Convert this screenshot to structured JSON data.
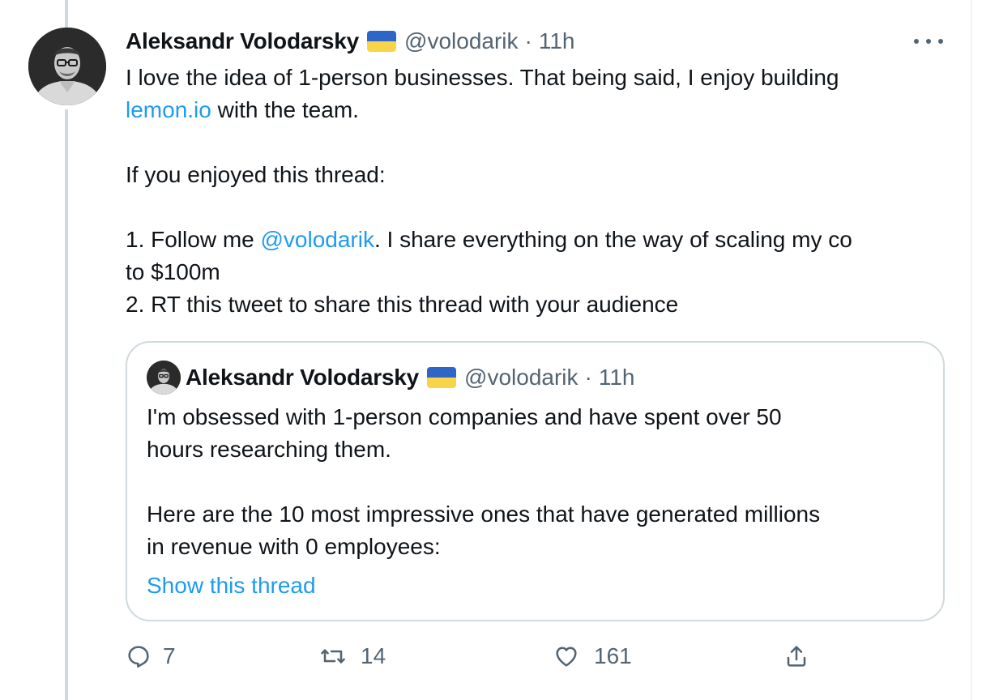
{
  "tweet": {
    "author_name": "Aleksandr Volodarsky",
    "handle": "@volodarik",
    "separator": "·",
    "time": "11h",
    "flag_icon": "ukraine-flag-icon",
    "body": {
      "line1": "I love the idea of 1-person businesses. That being said, I enjoy building",
      "link1": "lemon.io",
      "line2_rest": " with the team.",
      "line3": "If you enjoyed this thread:",
      "line4_start": "1. Follow me ",
      "mention": "@volodarik",
      "line4_rest": ". I share everything on the way of scaling my co",
      "line5": "to $100m",
      "line6": "2. RT this tweet to share this thread with your audience"
    }
  },
  "quoted_tweet": {
    "author_name": "Aleksandr Volodarsky",
    "handle": "@volodarik",
    "separator": "·",
    "time": "11h",
    "lines": [
      "I'm obsessed with 1-person companies and have spent over 50",
      "hours researching them.",
      "",
      "Here are the 10 most impressive ones that have generated millions",
      "in revenue with 0 employees:"
    ],
    "show_thread": "Show this thread"
  },
  "actions": {
    "replies": "7",
    "retweets": "14",
    "likes": "161"
  },
  "colors": {
    "link": "#1d9bf0",
    "muted": "#536471",
    "text": "#0f1419",
    "border": "#cfd9de",
    "flag_blue": "#2d66c6",
    "flag_yellow": "#f7d448"
  }
}
